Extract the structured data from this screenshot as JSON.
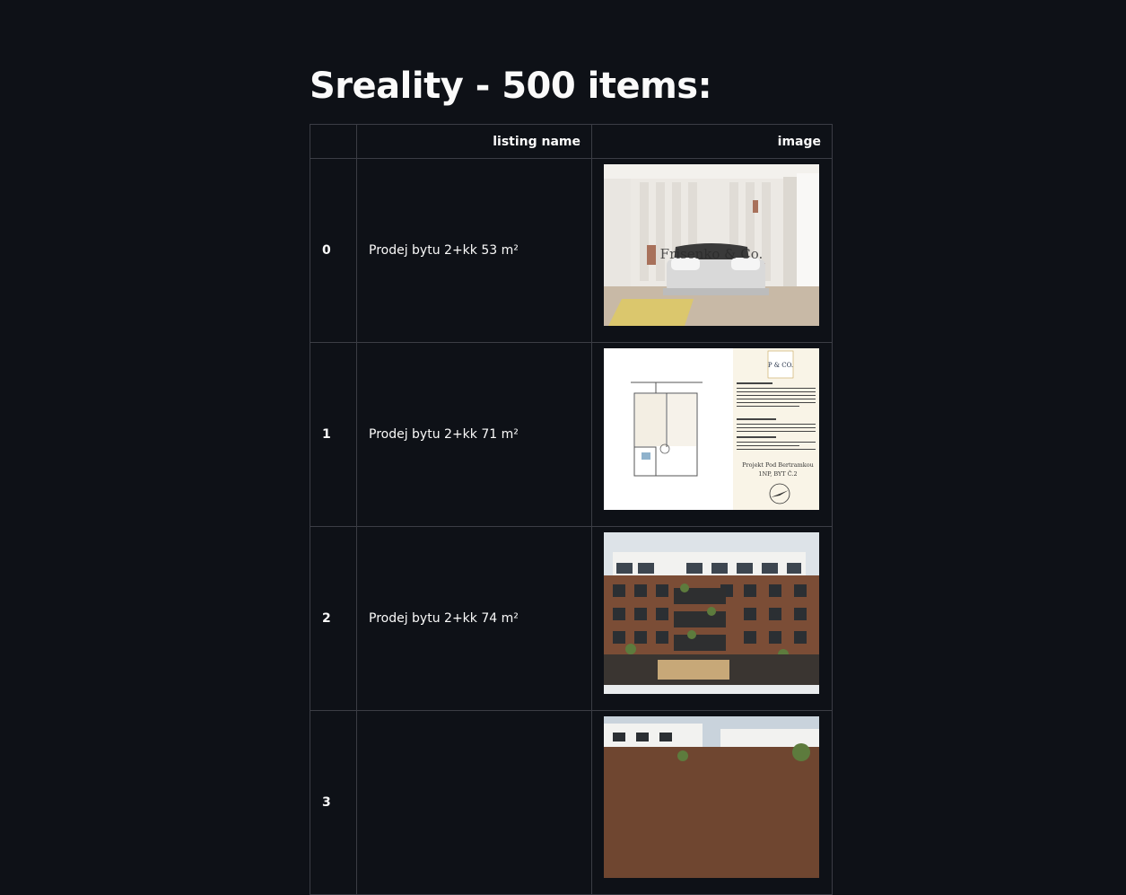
{
  "page": {
    "title": "Sreality - 500 items:"
  },
  "table": {
    "headers": [
      "",
      "listing name",
      "image"
    ],
    "rows": [
      {
        "index": "0",
        "listing_name": "Prodej bytu 2+kk 53 m²",
        "image": "bedroom-photo",
        "watermark": "Frisenko & Co."
      },
      {
        "index": "1",
        "listing_name": "Prodej bytu 2+kk 71 m²",
        "image": "floor-plan",
        "plan_caption_1": "Projekt Pod Bertramkou",
        "plan_caption_2": "1NP, BYT Č.2",
        "logo": "P & CO."
      },
      {
        "index": "2",
        "listing_name": "Prodej bytu 2+kk 74 m²",
        "image": "brick-building-photo"
      },
      {
        "index": "3",
        "listing_name": "",
        "image": "building-photo"
      }
    ]
  },
  "colors": {
    "background": "#0e1117",
    "text": "#fafafa",
    "border": "#3b3d45"
  }
}
